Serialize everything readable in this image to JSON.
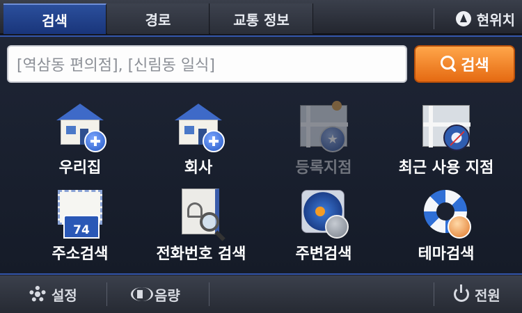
{
  "tabs": [
    {
      "label": "검색",
      "active": true
    },
    {
      "label": "경로",
      "active": false
    },
    {
      "label": "교통 정보",
      "active": false
    }
  ],
  "current_location_label": "현위치",
  "search": {
    "placeholder": "[역삼동 편의점], [신림동 일식]",
    "button_label": "검색"
  },
  "menu": [
    {
      "label": "우리집",
      "icon": "home-add-icon",
      "enabled": true
    },
    {
      "label": "회사",
      "icon": "office-add-icon",
      "enabled": true
    },
    {
      "label": "등록지점",
      "icon": "saved-place-icon",
      "enabled": false
    },
    {
      "label": "최근 사용 지점",
      "icon": "recent-place-icon",
      "enabled": true
    },
    {
      "label": "주소검색",
      "icon": "address-icon",
      "enabled": true
    },
    {
      "label": "전화번호 검색",
      "icon": "phonebook-icon",
      "enabled": true
    },
    {
      "label": "주변검색",
      "icon": "nearby-icon",
      "enabled": true
    },
    {
      "label": "테마검색",
      "icon": "theme-icon",
      "enabled": true
    }
  ],
  "address_sign_number": "74",
  "bottom_bar": {
    "settings_label": "설정",
    "volume_label": "음량",
    "power_label": "전원"
  },
  "colors": {
    "active_tab": "#1f3f8a",
    "search_button": "#f08a2a",
    "panel_border": "#3355aa"
  }
}
